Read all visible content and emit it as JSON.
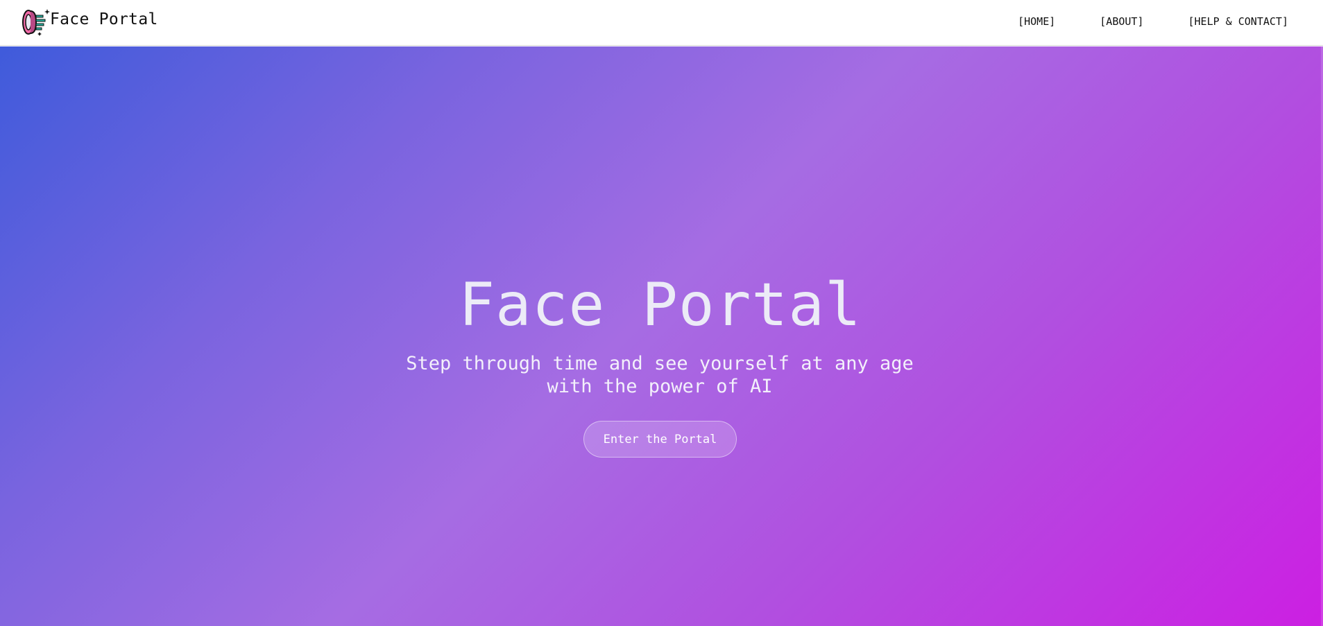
{
  "header": {
    "brand_name": "Face Portal",
    "logo_icon": "portal-face-icon",
    "nav": [
      {
        "label": "[HOME]"
      },
      {
        "label": "[ABOUT]"
      },
      {
        "label": "[HELP & CONTACT]"
      }
    ]
  },
  "hero": {
    "title": "Face Portal",
    "subtitle": "Step through time and see yourself at any age with the power of AI",
    "cta_label": "Enter the Portal"
  },
  "colors": {
    "gradient_start": "#3f5bdb",
    "gradient_mid": "#a66ce3",
    "gradient_end": "#cc1fe2",
    "logo_pink": "#f06aa6",
    "logo_teal": "#27b3a0"
  }
}
